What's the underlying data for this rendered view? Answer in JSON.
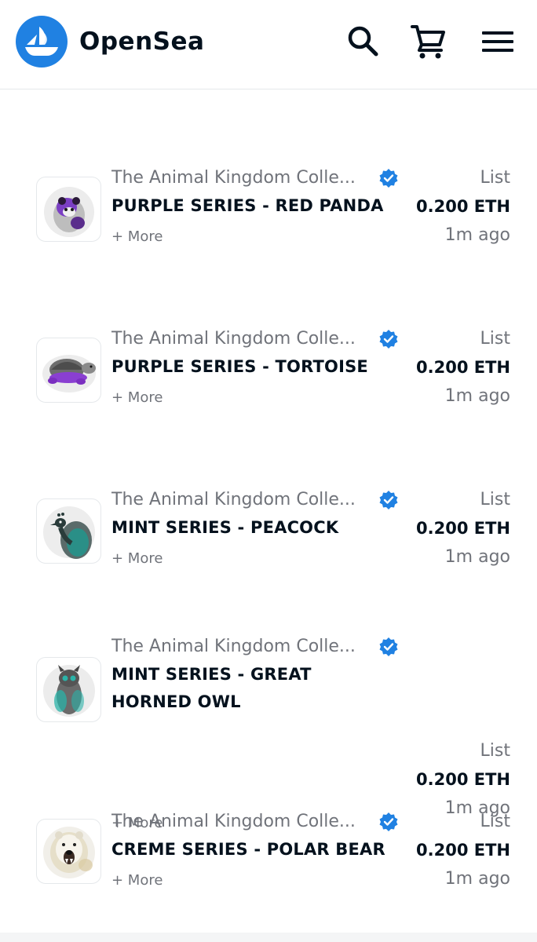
{
  "header": {
    "brand": "OpenSea",
    "logo_icon": "opensea-boat-icon",
    "search_icon": "search-icon",
    "cart_icon": "cart-icon",
    "menu_icon": "hamburger-menu-icon",
    "accent_color": "#2081e2"
  },
  "items": [
    {
      "collection": "The Animal Kingdom Colle...",
      "name": "PURPLE SERIES - RED PANDA",
      "more": "+ More",
      "event": "List",
      "price": "0.200 ETH",
      "time": "1m ago",
      "accent": "#8a3fd1"
    },
    {
      "collection": "The Animal Kingdom Colle...",
      "name": "PURPLE SERIES - TORTOISE",
      "more": "+ More",
      "event": "List",
      "price": "0.200 ETH",
      "time": "1m ago",
      "accent": "#7b2fc0"
    },
    {
      "collection": "The Animal Kingdom Colle...",
      "name": "MINT SERIES - PEACOCK",
      "more": "+ More",
      "event": "List",
      "price": "0.200 ETH",
      "time": "1m ago",
      "accent": "#1fa39a"
    },
    {
      "collection": "The Animal Kingdom Colle...",
      "name": "MINT SERIES - GREAT HORNED OWL",
      "more": "+ More",
      "event": "List",
      "price": "0.200 ETH",
      "time": "1m ago",
      "accent": "#2bb3a8"
    },
    {
      "collection": "The Animal Kingdom Colle...",
      "name": "CREME SERIES - POLAR BEAR",
      "more": "+ More",
      "event": "List",
      "price": "0.200 ETH",
      "time": "1m ago",
      "accent": "#d8c9a0"
    }
  ],
  "verified_icon": "verified-badge-icon",
  "verified_color": "#2081e2"
}
